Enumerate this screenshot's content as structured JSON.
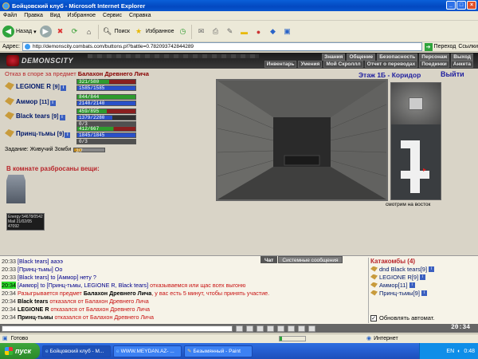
{
  "window": {
    "title": "Бойцовский клуб - Microsoft Internet Explorer"
  },
  "menu": [
    "Файл",
    "Правка",
    "Вид",
    "Избранное",
    "Сервис",
    "Справка"
  ],
  "toolbar": {
    "back": "Назад",
    "search": "Поиск",
    "favorites": "Избранное"
  },
  "address": {
    "label": "Адрес:",
    "url": "http://demonscity.combats.com/buttons.pl?battle=0.782093742844289",
    "go": "Переход",
    "links": "Ссылки"
  },
  "game": {
    "logo": "DEMONSCITY",
    "nav_top": [
      "Знания",
      "Общение",
      "Безопасность",
      "Персонаж",
      "Выход"
    ],
    "nav_bottom": [
      "Инвентарь",
      "Умения",
      "Мой Скроллл",
      "Отчет о переводах",
      "Поединки",
      "Анкета"
    ],
    "dispute_prefix": "Отказ в споре за предмет",
    "dispute_item": "Балахон Древнего Лича",
    "fighters": [
      {
        "name": "LEGIONE R",
        "level": "[9]",
        "hp": "321/580",
        "mp": "1585/1585",
        "stamina": "",
        "hp_frac": 0.55,
        "mp_frac": 1.0
      },
      {
        "name": "Аммор",
        "level": "[11]",
        "hp": "844/844",
        "mp": "2140/2140",
        "stamina": "",
        "hp_frac": 1.0,
        "mp_frac": 1.0
      },
      {
        "name": "Black tears",
        "level": "[9]",
        "hp": "459/895",
        "mp": "1379/2280",
        "stamina": "0/3",
        "hp_frac": 0.51,
        "mp_frac": 0.6
      },
      {
        "name": "Принц-тьмы",
        "level": "[9]",
        "hp": "412/667",
        "mp": "1845/1845",
        "stamina": "0/3",
        "hp_frac": 0.62,
        "mp_frac": 1.0
      }
    ],
    "task_label": "Задание: Живучий Зомби",
    "task_value": "2/7",
    "items_title": "В комнате разбросаны вещи:",
    "stat_box": {
      "l1": "Energy",
      "v1": "54678/0542",
      "l2": "Mail",
      "v2": "21/02/05",
      "v3": "47092"
    },
    "room_title": "Этаж 1Б - Коридор",
    "exit": "Выйти",
    "view_label": "смотрим на восток",
    "chat_tabs": [
      "Чат",
      "Системные сообщения"
    ],
    "chat_lines": [
      {
        "time": "20:33",
        "text": "[Black tears] ааээ",
        "hl": false,
        "kind": "pm"
      },
      {
        "time": "20:33",
        "text": "[Принц-тьмы] Оо",
        "hl": false,
        "kind": "pm"
      },
      {
        "time": "20:33",
        "text": "[Black tears] to [Аммор] нету ?",
        "hl": false,
        "kind": "pm"
      },
      {
        "time": "20:34",
        "text": "[Аммор] to [Принц-тьмы, LEGIONE R, Black tears]",
        "extra": "отказываемся или щас всех выгоню",
        "hl": true,
        "kind": "pm"
      },
      {
        "time": "20:34",
        "text": "Разыгрывается предмет",
        "item": "Балахон Древнего Лича",
        "extra": ", у вас есть 5 минут, чтобы принять участие.",
        "hl": false,
        "kind": "sys"
      },
      {
        "time": "20:34",
        "who": "Black tears",
        "text": "отказался от Балахон Древнего Лича",
        "hl": false,
        "kind": "sys"
      },
      {
        "time": "20:34",
        "who": "LEGIONE R",
        "text": "отказался от Балахон Древнего Лича",
        "hl": false,
        "kind": "sys"
      },
      {
        "time": "20:34",
        "who": "Принц-тьмы",
        "text": "отказался от Балахон Древнего Лича",
        "hl": false,
        "kind": "sys"
      }
    ],
    "room_panel": {
      "title": "Катакомбы (4)",
      "users": [
        {
          "name": "dnd Black tears[9]"
        },
        {
          "name": "LEGIONE R[9]"
        },
        {
          "name": "Аммор[11]"
        },
        {
          "name": "Принц-тьмы[9]"
        }
      ],
      "auto_refresh": "Обновлять автомат."
    },
    "clock": "20:34"
  },
  "status": {
    "text": "Готово",
    "zone": "Интернет"
  },
  "taskbar": {
    "start": "пуск",
    "tasks": [
      "Бойцовский клуб - М...",
      "WWW.MEYDAN.AZ- ...",
      "Безымянный - Paint"
    ],
    "lang": "EN",
    "time": "0:48"
  }
}
